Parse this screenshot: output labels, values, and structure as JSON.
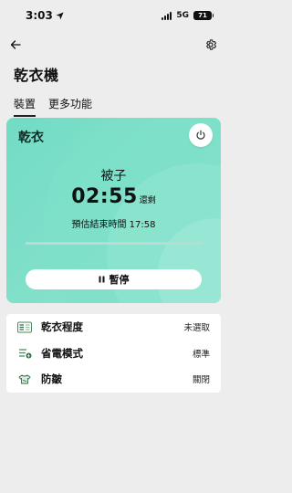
{
  "status_bar": {
    "time": "3:03",
    "network": "5G",
    "battery": "71"
  },
  "header": {
    "title": "乾衣機"
  },
  "tabs": [
    {
      "label": "裝置",
      "active": true
    },
    {
      "label": "更多功能",
      "active": false
    }
  ],
  "status_card": {
    "label": "乾衣",
    "program": "被子",
    "remaining_time": "02:55",
    "remaining_unit": "還剩",
    "end_time_text": "預估結束時間 17:58",
    "progress": 0,
    "pause_label": "暫停",
    "accent_color": "#6dd9c1"
  },
  "settings": [
    {
      "icon": "dryness-level-icon",
      "label": "乾衣程度",
      "value": "未選取"
    },
    {
      "icon": "energy-saving-icon",
      "label": "省電模式",
      "value": "標準"
    },
    {
      "icon": "wrinkle-prevent-icon",
      "label": "防皺",
      "value": "關閉"
    }
  ]
}
